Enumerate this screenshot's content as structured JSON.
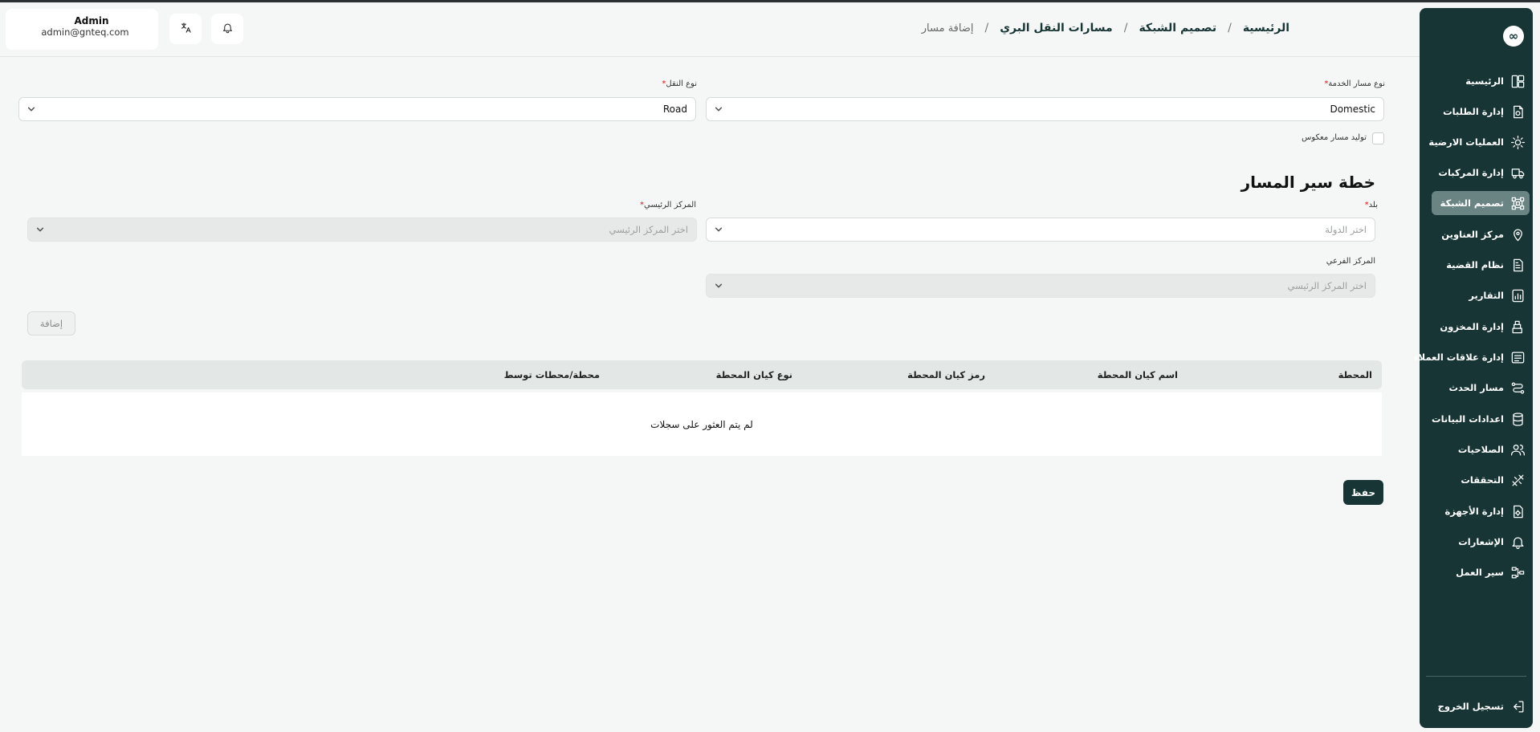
{
  "header": {
    "user": {
      "name": "Admin",
      "email": "admin@gnteq.com"
    },
    "breadcrumb": [
      "الرئيسية",
      "تصميم الشبكة",
      "مسارات النقل البري",
      "إضافة مسار"
    ],
    "icons": {
      "translate": "translate-icon",
      "notifications": "bell-icon"
    }
  },
  "sidebar": {
    "logo": "∞",
    "items": [
      {
        "label": "الرئيسية",
        "icon": "dashboard-icon",
        "active": false
      },
      {
        "label": "إدارة الطلبات",
        "icon": "orders-icon",
        "active": false
      },
      {
        "label": "العمليات الارضية",
        "icon": "ground-operations-icon",
        "active": false
      },
      {
        "label": "إدارة المركبات",
        "icon": "truck-icon",
        "active": false
      },
      {
        "label": "تصميم الشبكة",
        "icon": "network-icon",
        "active": true
      },
      {
        "label": "مركز العناوين",
        "icon": "location-icon",
        "active": false
      },
      {
        "label": "نظام القضية",
        "icon": "case-icon",
        "active": false
      },
      {
        "label": "التقارير",
        "icon": "reports-icon",
        "active": false
      },
      {
        "label": "إدارة المخزون",
        "icon": "inventory-icon",
        "active": false
      },
      {
        "label": "إدارة علاقات العملاء",
        "icon": "crm-icon",
        "active": false
      },
      {
        "label": "مسار الحدث",
        "icon": "event-route-icon",
        "active": false
      },
      {
        "label": "اعدادات البيانات",
        "icon": "database-icon",
        "active": false
      },
      {
        "label": "الصلاحيات",
        "icon": "users-icon",
        "active": false
      },
      {
        "label": "التحققات",
        "icon": "validation-icon",
        "active": false
      },
      {
        "label": "إدارة الأجهزة",
        "icon": "device-icon",
        "active": false
      },
      {
        "label": "الإشعارات",
        "icon": "bell-icon",
        "active": false
      },
      {
        "label": "سير العمل",
        "icon": "workflow-icon",
        "active": false
      }
    ],
    "logout": {
      "label": "تسجيل الخروج",
      "icon": "logout-icon"
    }
  },
  "form": {
    "service_route_type": {
      "label": "نوع مسار الخدمة",
      "value": "Domestic"
    },
    "transport_type": {
      "label": "نوع النقل",
      "value": "Road"
    },
    "reverse_route": {
      "label": "توليد مسار معكوس",
      "checked": false
    },
    "section_title": "خطة سير المسار",
    "country": {
      "label": "بلد",
      "placeholder": "اختر الدولة"
    },
    "main_hub": {
      "label": "المركز الرئيسي",
      "placeholder": "اختر المركز الرئيسي"
    },
    "sub_hub": {
      "label": "المركز الفرعي",
      "placeholder": "اختر المركز الرئيسي"
    },
    "add_label": "إضافة"
  },
  "table": {
    "columns": [
      "المحطة",
      "اسم كيان المحطة",
      "رمز كيان المحطة",
      "نوع كيان المحطة",
      "محطة/محطات توسط"
    ],
    "empty_message": "لم يتم العثور على سجلات"
  },
  "save_label": "حفظ",
  "colors": {
    "primary": "#173535",
    "active_nav": "#6a8484",
    "background": "#f5f7f6",
    "required": "#dd1111"
  }
}
